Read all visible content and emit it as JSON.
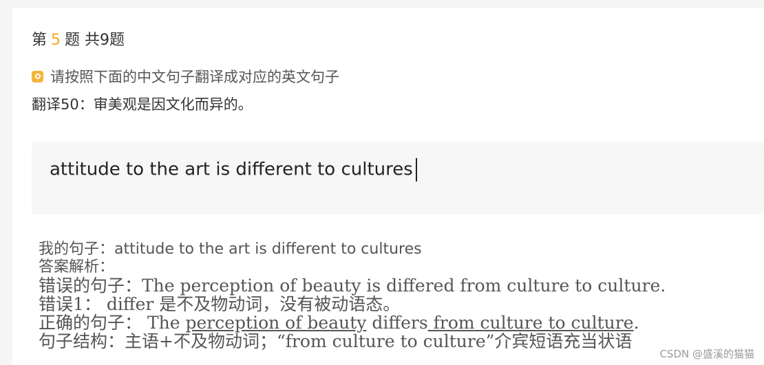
{
  "question": {
    "prefix": "第",
    "number": "5",
    "suffix": "题 共9题",
    "instruction": "请按照下面的中文句子翻译成对应的英文句子",
    "prompt": "翻译50：审美观是因文化而异的。"
  },
  "answer_input": {
    "value": "attitude to the art is different to cultures"
  },
  "analysis": {
    "my_sentence": "我的句子：attitude to the art is different to cultures",
    "label": "答案解析：",
    "wrong_sentence": "错误的句子：The  perception of beauty is differed from culture to culture.",
    "error1": "错误1：  differ 是不及物动词，没有被动语态。",
    "correct_label": "正确的句子：  ",
    "correct_parts": [
      " The ",
      "perception of beauty",
      " differs",
      " from culture to culture",
      "."
    ],
    "structure": "句子结构：主语+不及物动词；“from culture to culture”介宾短语充当状语"
  },
  "watermark": "CSDN @盛溪的猫猫",
  "colors": {
    "accent": "#f5a623",
    "icon": "#f5b43a"
  }
}
